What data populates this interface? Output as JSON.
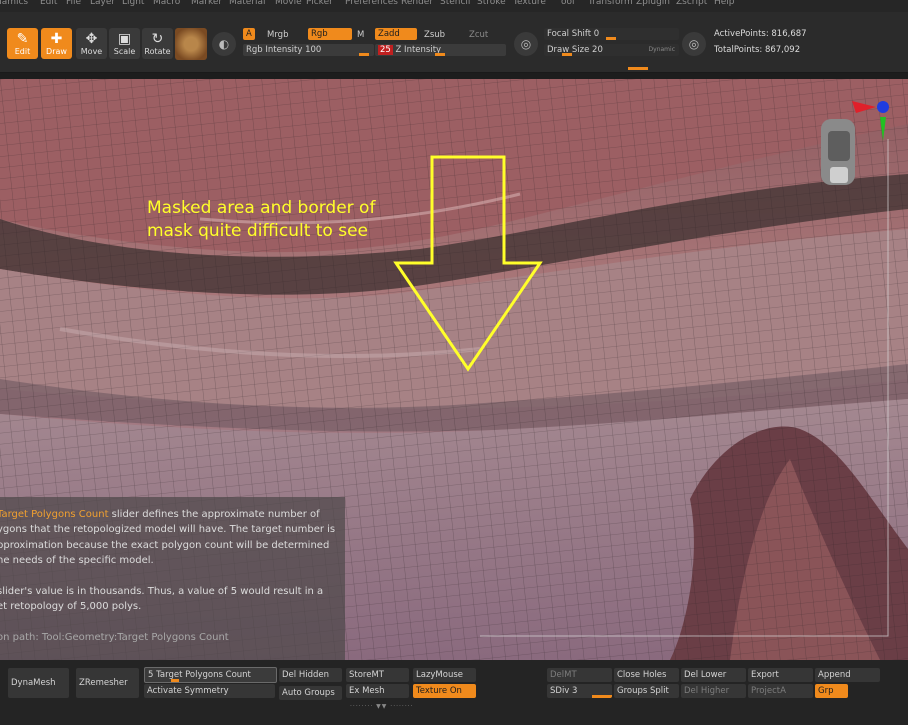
{
  "menu": [
    "namics",
    "Edit",
    "File",
    "Layer",
    "Light",
    "Macro",
    "Marker",
    "Material",
    "Movie",
    "Picker",
    "Preferences",
    "Render",
    "Stencil",
    "Stroke",
    "Texture",
    "ool",
    "Transform",
    "Zplugin",
    "Zscript",
    "Help"
  ],
  "toolbar": {
    "edit_label": "Edit",
    "draw_label": "Draw",
    "move_label": "Move",
    "scale_label": "Scale",
    "rotate_label": "Rotate",
    "a_label": "A",
    "mrgb_label": "Mrgb",
    "rgb_label": "Rgb",
    "m_label": "M",
    "zadd_label": "Zadd",
    "zsub_label": "Zsub",
    "zcut_label": "Zcut",
    "rgb_intensity_label": "Rgb Intensity 100",
    "z_intensity_value": "25",
    "z_intensity_label": "Z Intensity",
    "focal_shift_label": "Focal Shift 0",
    "draw_size_label": "Draw Size 20",
    "dynamic_label": "Dynamic",
    "active_points": "ActivePoints: 816,687",
    "total_points": "TotalPoints: 867,092"
  },
  "annotation": {
    "line1": "Masked area and border of",
    "line2": "mask quite difficult to see",
    "color": "#ffff2a"
  },
  "info": {
    "p1a": "Target Polygons Count",
    "p1b": " slider defines the approximate number of",
    "p2": "ygons that the retopologized model will have. The target number is",
    "p3": "pproximation because the exact polygon count will be determined",
    "p4": "he needs of the specific model.",
    "p5": "slider's value is in thousands. Thus, a value of 5 would result in a",
    "p6": "et retopology of 5,000 polys.",
    "p7": "on path: Tool:Geometry:Target Polygons Count"
  },
  "bottom": {
    "dynamesh": "DynaMesh",
    "zremesher": "ZRemesher",
    "target_polygons": "5 Target Polygons Count",
    "activate_symmetry": "Activate Symmetry",
    "del_hidden": "Del Hidden",
    "auto_groups": "Auto Groups",
    "store_mt": "StoreMT",
    "ex_mesh": "Ex Mesh",
    "lazymouse": "LazyMouse",
    "texture_on": "Texture On",
    "del_mt": "DelMT",
    "sdiv": "SDiv 3",
    "close_holes": "Close Holes",
    "groups_split": "Groups Split",
    "del_lower": "Del Lower",
    "del_higher": "Del Higher",
    "export": "Export",
    "projecta": "ProjectA",
    "append": "Append",
    "grp": "Grp"
  },
  "colors": {
    "accent": "#f08a1c",
    "panel": "#2b2b2b"
  }
}
